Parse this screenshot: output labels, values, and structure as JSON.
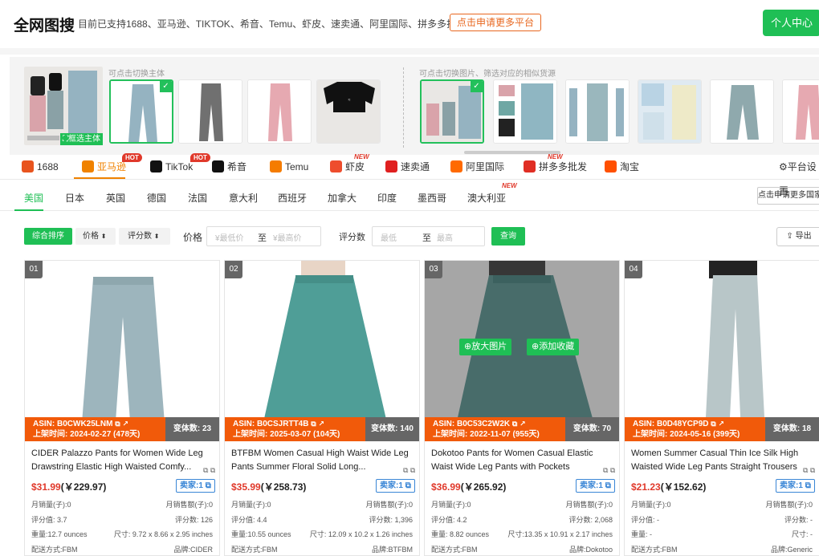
{
  "header": {
    "title": "全网图搜",
    "subtitle": "目前已支持1688、亚马逊、TIKTOK、希音、Temu、虾皮、速卖通、阿里国际、拼多多批发、淘宝",
    "apply_label": "点击申请更多平台",
    "user_center": "个人中心"
  },
  "search_panel": {
    "switch_subject_hint": "可点击切换主体",
    "switch_image_hint": "可点击切换图片、筛选对应的相似货源",
    "refine_label": "框选主体",
    "check_icon": "check-icon"
  },
  "platform_tabs": [
    {
      "label": "1688",
      "color": "#e8541e",
      "badge": ""
    },
    {
      "label": "亚马逊",
      "color": "#f08200",
      "badge": "HOT",
      "active": true
    },
    {
      "label": "TikTok",
      "color": "#111111",
      "badge": "HOT"
    },
    {
      "label": "希音",
      "color": "#111111",
      "badge": ""
    },
    {
      "label": "Temu",
      "color": "#f57c00",
      "badge": ""
    },
    {
      "label": "虾皮",
      "color": "#ee4d2d",
      "badge": "NEW"
    },
    {
      "label": "速卖通",
      "color": "#e02020",
      "badge": ""
    },
    {
      "label": "阿里国际",
      "color": "#ff6a00",
      "badge": ""
    },
    {
      "label": "拼多多批发",
      "color": "#e02e24",
      "badge": "NEW"
    },
    {
      "label": "淘宝",
      "color": "#ff5000",
      "badge": ""
    }
  ],
  "platform_settings": "平台设置",
  "country_tabs": [
    {
      "label": "美国",
      "active": true
    },
    {
      "label": "日本"
    },
    {
      "label": "英国"
    },
    {
      "label": "德国"
    },
    {
      "label": "法国"
    },
    {
      "label": "意大利"
    },
    {
      "label": "西班牙"
    },
    {
      "label": "加拿大"
    },
    {
      "label": "印度"
    },
    {
      "label": "墨西哥"
    },
    {
      "label": "澳大利亚",
      "badge": "NEW"
    }
  ],
  "more_sites": "点击申请更多国家",
  "filters": {
    "sort_default": "综合排序",
    "sort_price": "价格",
    "sort_rating_count": "评分数",
    "price_label": "价格",
    "price_min_ph": "¥最低价",
    "price_to": "至",
    "price_max_ph": "¥最高价",
    "rating_label": "评分数",
    "rating_min_ph": "最低",
    "rating_to": "至",
    "rating_max_ph": "最高",
    "query": "查询",
    "export": "导出"
  },
  "products": [
    {
      "idx": "01",
      "asin": "ASIN:  B0CWK25LNM",
      "listed": "上架时间:   2024-02-27  (478天)",
      "variants": "变体数: 23",
      "title": "CIDER Palazzo Pants for Women Wide Leg Drawstring Elastic High Waisted Comfy...",
      "price_usd": "$31.99",
      "price_cny": "(￥229.97)",
      "seller": "卖家:1",
      "monthly_sales": "月销量(子):0",
      "monthly_rev": "月销售额(子):0",
      "rating": "评分值: 3.7",
      "rating_count": "评分数: 126",
      "weight": "重量:12.7 ounces",
      "size": "尺寸: 9.72 x 8.66 x 2.95 inches",
      "ship": "配送方式:FBM",
      "brand": "品牌:CIDER",
      "pants": "#9db5bd",
      "bg": "#ffffff"
    },
    {
      "idx": "02",
      "asin": "ASIN:  B0CSJRTT4B",
      "listed": "上架时间:   2025-03-07  (104天)",
      "variants": "变体数: 140",
      "title": "BTFBM Women Casual High Waist Wide Leg Pants Summer Floral Solid Long...",
      "price_usd": "$35.99",
      "price_cny": "(￥258.73)",
      "seller": "卖家:1",
      "monthly_sales": "月销量(子):0",
      "monthly_rev": "月销售额(子):0",
      "rating": "评分值: 4.4",
      "rating_count": "评分数: 1,396",
      "weight": "重量:10.55 ounces",
      "size": "尺寸: 12.09 x 10.2 x 1.26 inches",
      "ship": "配送方式:FBM",
      "brand": "品牌:BTFBM",
      "pants": "#4f9e97",
      "bg": "#ffffff"
    },
    {
      "idx": "03",
      "asin": "ASIN:  B0C53C2W2K",
      "listed": "上架时间:   2022-11-07  (955天)",
      "variants": "变体数: 70",
      "title": "Dokotoo Pants for Women Casual Elastic Waist Wide Leg Pants with Pockets",
      "price_usd": "$36.99",
      "price_cny": "(￥265.92)",
      "seller": "卖家:1",
      "monthly_sales": "月销量(子):0",
      "monthly_rev": "月销售额(子):0",
      "rating": "评分值: 4.2",
      "rating_count": "评分数: 2,068",
      "weight": "重量: 8.82 ounces",
      "size": "尺寸:13.35 x 10.91 x 2.17 inches",
      "ship": "配送方式:FBM",
      "brand": "品牌:Dokotoo",
      "pants": "#6fa7a4",
      "bg": "#ffffff",
      "zoom": "放大图片",
      "fav": "添加收藏"
    },
    {
      "idx": "04",
      "asin": "ASIN:  B0D48YCP9D",
      "listed": "上架时间:   2024-05-16  (399天)",
      "variants": "变体数: 18",
      "title": "Women Summer Casual Thin Ice Silk High Waisted Wide Leg Pants Straight Trousers",
      "price_usd": "$21.23",
      "price_cny": "(￥152.62)",
      "seller": "卖家:1",
      "monthly_sales": "月销量(子):0",
      "monthly_rev": "月销售额(子):0",
      "rating": "评分值: -",
      "rating_count": "评分数: -",
      "weight": "重量: -",
      "size": "尺寸: -",
      "ship": "配送方式:FBM",
      "brand": "品牌:Generic",
      "pants": "#b8c6c8",
      "bg": "#ffffff"
    }
  ]
}
